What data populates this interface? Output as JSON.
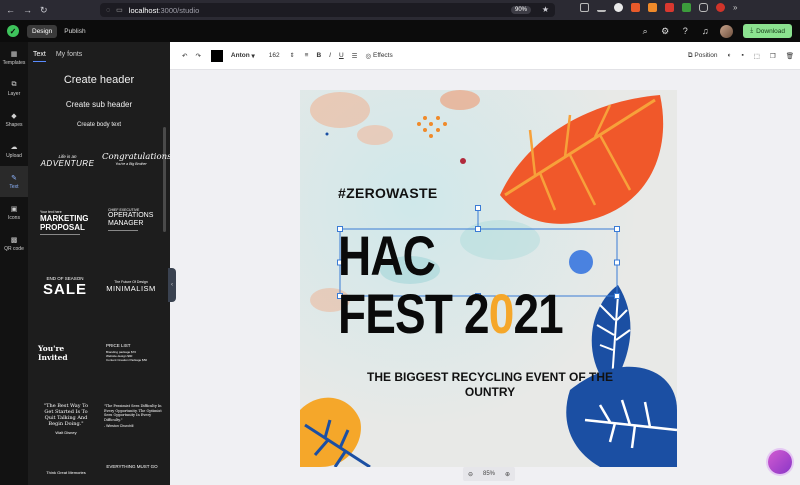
{
  "browser": {
    "url_host": "localhost",
    "url_rest": ":3000/studio",
    "zoom": "90%"
  },
  "app": {
    "tabs": [
      "Design",
      "Publish"
    ],
    "download_label": "Download"
  },
  "rail": {
    "items": [
      {
        "label": "Templates",
        "icon": "templates-icon"
      },
      {
        "label": "Layer",
        "icon": "layer-icon"
      },
      {
        "label": "Shapes",
        "icon": "shapes-icon"
      },
      {
        "label": "Upload",
        "icon": "upload-icon"
      },
      {
        "label": "Text",
        "icon": "text-icon"
      },
      {
        "label": "Icons",
        "icon": "icons-icon"
      },
      {
        "label": "QR code",
        "icon": "qr-code-icon"
      }
    ]
  },
  "panel": {
    "tabs": [
      "Text",
      "My fonts"
    ],
    "create_header": "Create header",
    "create_sub_header": "Create sub header",
    "create_body_text": "Create body text",
    "templates": {
      "t1_small": "Life is an",
      "t1_big": "ADVENTURE",
      "t2_big": "Congratulations!",
      "t2_small": "You're a Big Brother",
      "t3_small": "Your text here",
      "t3_big": "MARKETING PROPOSAL",
      "t4_small": "CHIEF EXECUTIVE",
      "t4_big": "OPERATIONS MANAGER",
      "t5_small": "END OF SEASON",
      "t5_big": "SALE",
      "t6_small": "The Future Of Design",
      "t6_big": "MINIMALISM",
      "t7_big": "You're Invited",
      "t8_title": "PRICE LIST",
      "t8_rows": [
        "Branding package   $70",
        "Website design   $90",
        "Content Creation Package   $50"
      ],
      "t9_quote": "\"The Best Way To Get Started Is To Quit Talking And Begin Doing.\"",
      "t9_author": "Walt Disney",
      "t10_quote": "\"The Pessimist Sees Difficulty In Every Opportunity. The Optimist Sees Opportunity In Every Difficulty.\"",
      "t10_author": "- Winston Churchill",
      "t11_small": "Think Great Memories",
      "t12_small": "EVERYTHING MUST GO"
    }
  },
  "toolbar": {
    "font_name": "Anton",
    "font_size": "162",
    "effects_label": "Effects",
    "position_label": "Position"
  },
  "poster": {
    "hashtag": "#ZEROWASTE",
    "line1": "HAC",
    "line2_a": "FEST 2",
    "line2_o": "0",
    "line2_b": "21",
    "sub1": "THE BIGGEST RECYCLING EVENT OF THE",
    "sub2": "OUNTRY"
  },
  "zoom": {
    "value": "85%"
  },
  "colors": {
    "accent_green": "#8be28f",
    "orange_leaf": "#f0582a",
    "blue_leaf": "#1b4fa3",
    "yellow_leaf": "#f5a72a",
    "selection": "#3a7bd5"
  }
}
